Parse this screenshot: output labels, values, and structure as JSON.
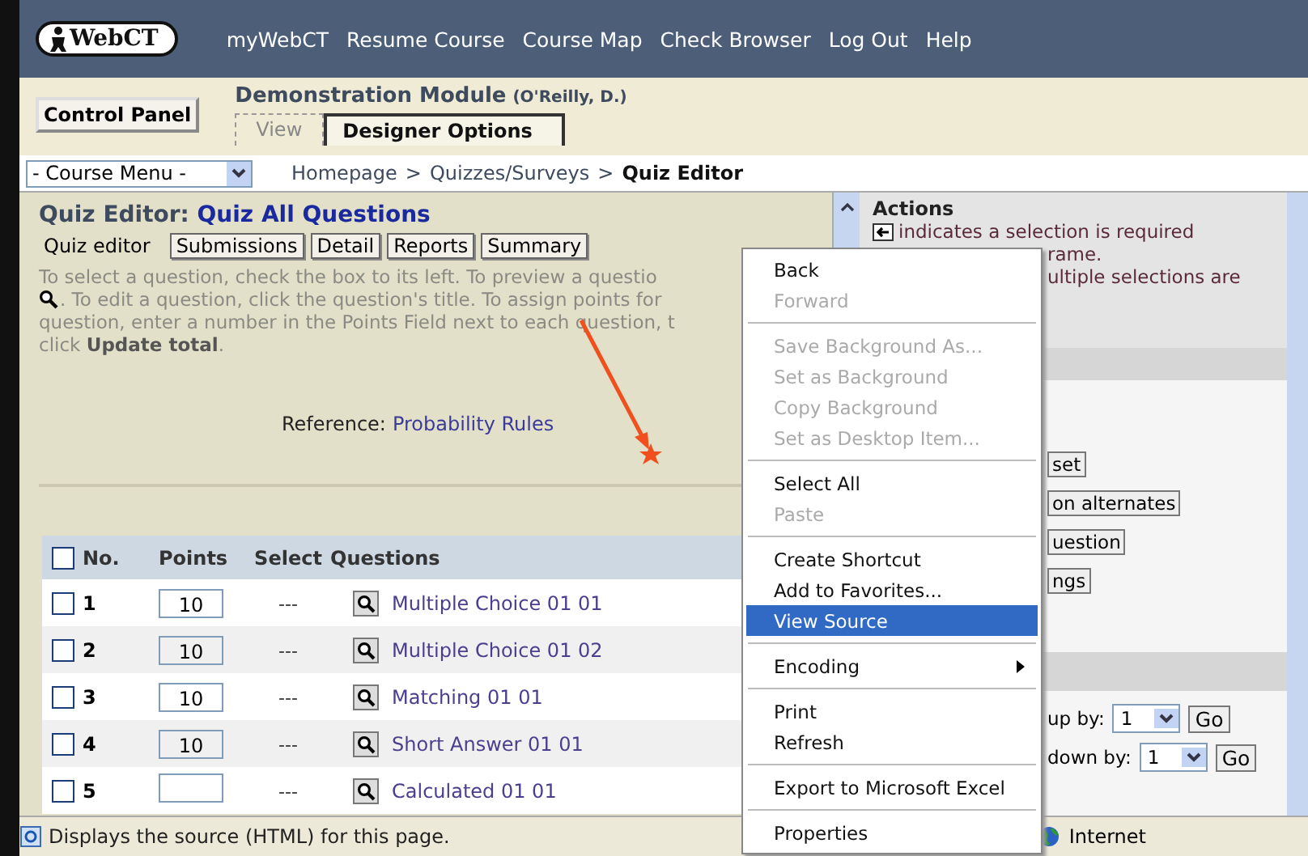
{
  "nav": {
    "logo": "WebCT",
    "links": [
      "myWebCT",
      "Resume Course",
      "Course Map",
      "Check Browser",
      "Log Out",
      "Help"
    ]
  },
  "header": {
    "control_panel": "Control Panel",
    "course_title": "Demonstration Module",
    "instructor": "(O'Reilly, D.)",
    "tabs": [
      {
        "label": "View",
        "selected": false
      },
      {
        "label": "Designer Options",
        "selected": true
      }
    ]
  },
  "course_menu": {
    "value": "- Course Menu -"
  },
  "breadcrumb": {
    "separator": ">",
    "items": [
      {
        "label": "Homepage",
        "current": false
      },
      {
        "label": "Quizzes/Surveys",
        "current": false
      },
      {
        "label": "Quiz Editor",
        "current": true
      }
    ]
  },
  "quiz": {
    "title_prefix": "Quiz Editor:",
    "title": "Quiz All Questions",
    "tabs": [
      {
        "label": "Quiz editor",
        "selected": true
      },
      {
        "label": "Submissions",
        "selected": false
      },
      {
        "label": "Detail",
        "selected": false
      },
      {
        "label": "Reports",
        "selected": false
      },
      {
        "label": "Summary",
        "selected": false
      }
    ],
    "instructions": [
      "To select a question, check the box to its left. To preview a questio",
      ". To edit a question, click the question's title. To assign points for",
      "question, enter a number in the Points Field next to each question, t",
      "click **Update total**."
    ],
    "reference_label": "Reference:",
    "reference_link": "Probability Rules"
  },
  "table": {
    "select_all_checked": false,
    "columns": [
      "No.",
      "Points",
      "Select",
      "Questions"
    ],
    "rows": [
      {
        "no": "1",
        "points": "10",
        "select": "---",
        "question": "Multiple Choice 01 01",
        "checked": false
      },
      {
        "no": "2",
        "points": "10",
        "select": "---",
        "question": "Multiple Choice 01 02",
        "checked": false
      },
      {
        "no": "3",
        "points": "10",
        "select": "---",
        "question": "Matching 01 01",
        "checked": false
      },
      {
        "no": "4",
        "points": "10",
        "select": "---",
        "question": "Short Answer 01 01",
        "checked": false
      },
      {
        "no": "5",
        "select": "---",
        "question": "Calculated 01 01",
        "checked": false
      }
    ]
  },
  "actions": {
    "title": "Actions",
    "notes": [
      "indicates a selection is required",
      "rame.",
      "ultiple selections are"
    ],
    "buttons": [
      "set",
      "on alternates",
      "uestion",
      "ngs"
    ],
    "moves": [
      {
        "label": "up by:",
        "value": "1",
        "button": "Go"
      },
      {
        "label": "down by:",
        "value": "1",
        "button": "Go"
      }
    ]
  },
  "context_menu": [
    {
      "kind": "item",
      "label": "Back",
      "disabled": false,
      "selected": false
    },
    {
      "kind": "item",
      "label": "Forward",
      "disabled": true,
      "selected": false
    },
    {
      "kind": "separator"
    },
    {
      "kind": "item",
      "label": "Save Background As...",
      "disabled": true,
      "selected": false
    },
    {
      "kind": "item",
      "label": "Set as Background",
      "disabled": true,
      "selected": false
    },
    {
      "kind": "item",
      "label": "Copy Background",
      "disabled": true,
      "selected": false
    },
    {
      "kind": "item",
      "label": "Set as Desktop Item...",
      "disabled": true,
      "selected": false
    },
    {
      "kind": "separator"
    },
    {
      "kind": "item",
      "label": "Select All",
      "disabled": false,
      "selected": false
    },
    {
      "kind": "item",
      "label": "Paste",
      "disabled": true,
      "selected": false
    },
    {
      "kind": "separator"
    },
    {
      "kind": "item",
      "label": "Create Shortcut",
      "disabled": false,
      "selected": false
    },
    {
      "kind": "item",
      "label": "Add to Favorites...",
      "disabled": false,
      "selected": false
    },
    {
      "kind": "item",
      "label": "View Source",
      "disabled": false,
      "selected": true
    },
    {
      "kind": "separator"
    },
    {
      "kind": "submenu",
      "label": "Encoding",
      "disabled": false,
      "selected": false
    },
    {
      "kind": "separator"
    },
    {
      "kind": "item",
      "label": "Print",
      "disabled": false,
      "selected": false
    },
    {
      "kind": "item",
      "label": "Refresh",
      "disabled": false,
      "selected": false
    },
    {
      "kind": "separator"
    },
    {
      "kind": "item",
      "label": "Export to Microsoft Excel",
      "disabled": false,
      "selected": false
    },
    {
      "kind": "separator"
    },
    {
      "kind": "item",
      "label": "Properties",
      "disabled": false,
      "selected": false
    }
  ],
  "status_bar": {
    "message": "Displays the source (HTML) for this page.",
    "zone": "Internet"
  }
}
